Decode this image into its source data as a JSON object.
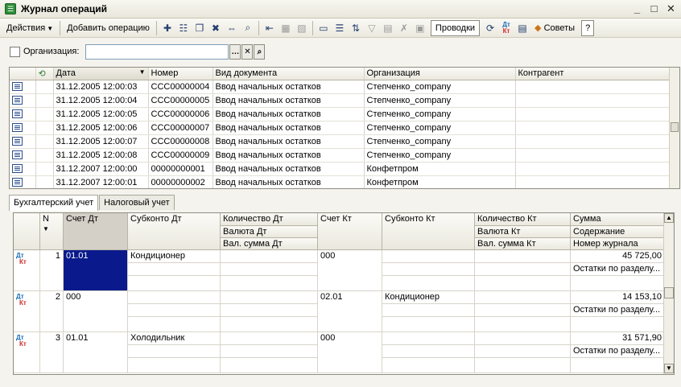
{
  "window": {
    "title": "Журнал операций"
  },
  "toolbar": {
    "actions_label": "Действия",
    "add_operation_label": "Добавить операцию",
    "postings_label": "Проводки",
    "tips_label": "Советы",
    "dtkt_dt": "Дт",
    "dtkt_kt": "Кт"
  },
  "filter": {
    "label": "Организация:",
    "value": ""
  },
  "journal": {
    "columns": [
      "Дата",
      "Номер",
      "Вид документа",
      "Организация",
      "Контрагент"
    ],
    "rows": [
      {
        "date": "31.12.2005 12:00:03",
        "number": "ССС00000004",
        "type": "Ввод начальных остатков",
        "org": "Степченко_company",
        "contractor": ""
      },
      {
        "date": "31.12.2005 12:00:04",
        "number": "ССС00000005",
        "type": "Ввод начальных остатков",
        "org": "Степченко_company",
        "contractor": ""
      },
      {
        "date": "31.12.2005 12:00:05",
        "number": "ССС00000006",
        "type": "Ввод начальных остатков",
        "org": "Степченко_company",
        "contractor": ""
      },
      {
        "date": "31.12.2005 12:00:06",
        "number": "ССС00000007",
        "type": "Ввод начальных остатков",
        "org": "Степченко_company",
        "contractor": ""
      },
      {
        "date": "31.12.2005 12:00:07",
        "number": "ССС00000008",
        "type": "Ввод начальных остатков",
        "org": "Степченко_company",
        "contractor": ""
      },
      {
        "date": "31.12.2005 12:00:08",
        "number": "ССС00000009",
        "type": "Ввод начальных остатков",
        "org": "Степченко_company",
        "contractor": ""
      },
      {
        "date": "31.12.2007 12:00:00",
        "number": "00000000001",
        "type": "Ввод начальных остатков",
        "org": "Конфетпром",
        "contractor": ""
      },
      {
        "date": "31.12.2007 12:00:01",
        "number": "00000000002",
        "type": "Ввод начальных остатков",
        "org": "Конфетпром",
        "contractor": ""
      }
    ]
  },
  "tabs": [
    {
      "label": "Бухгалтерский учет",
      "active": true
    },
    {
      "label": "Налоговый учет",
      "active": false
    }
  ],
  "postings": {
    "headers": {
      "n": "N",
      "dt_account": "Счет Дт",
      "dt_subconto": "Субконто Дт",
      "dt_qty": "Количество Дт",
      "dt_currency": "Валюта Дт",
      "dt_cur_sum": "Вал. сумма Дт",
      "kt_account": "Счет Кт",
      "kt_subconto": "Субконто Кт",
      "kt_qty": "Количество Кт",
      "kt_currency": "Валюта Кт",
      "kt_cur_sum": "Вал. сумма Кт",
      "sum": "Сумма",
      "content": "Содержание",
      "journal_no": "Номер журнала"
    },
    "rows": [
      {
        "n": "1",
        "dt_account": "01.01",
        "dt_subconto": "Кондиционер",
        "kt_account": "000",
        "kt_subconto": "",
        "sum": "45 725,00",
        "content": "Остатки по разделу..."
      },
      {
        "n": "2",
        "dt_account": "000",
        "dt_subconto": "",
        "kt_account": "02.01",
        "kt_subconto": "Кондиционер",
        "sum": "14 153,10",
        "content": "Остатки по разделу..."
      },
      {
        "n": "3",
        "dt_account": "01.01",
        "dt_subconto": "Холодильник",
        "kt_account": "000",
        "kt_subconto": "",
        "sum": "31 571,90",
        "content": "Остатки по разделу..."
      }
    ]
  }
}
